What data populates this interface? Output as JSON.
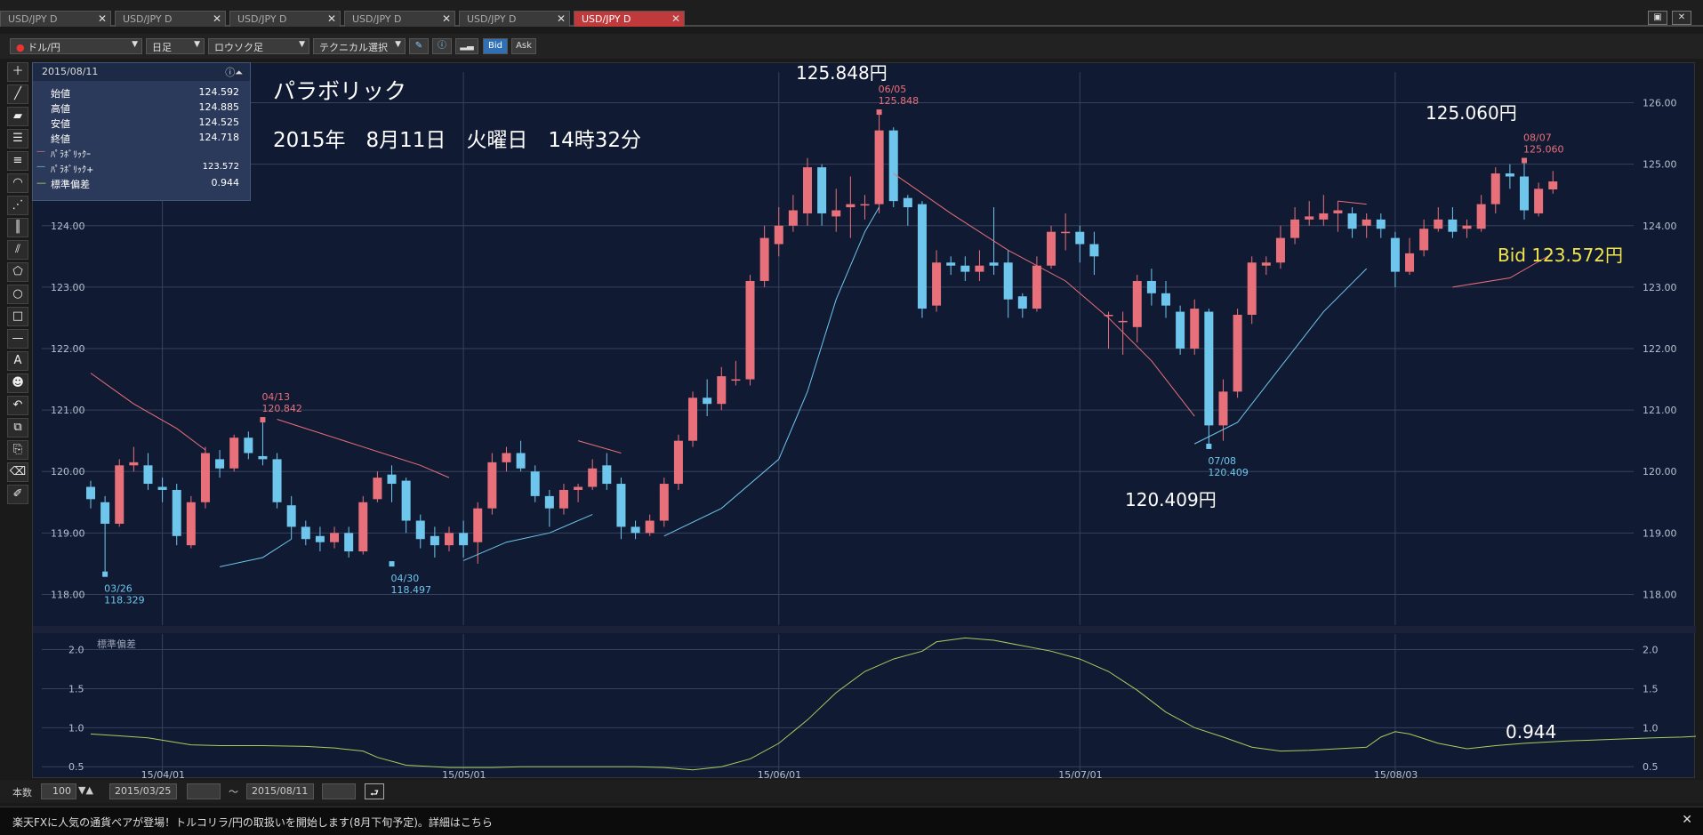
{
  "tabs": [
    {
      "label": "USD/JPY D",
      "active": false
    },
    {
      "label": "USD/JPY D",
      "active": false
    },
    {
      "label": "USD/JPY D",
      "active": false
    },
    {
      "label": "USD/JPY D",
      "active": false
    },
    {
      "label": "USD/JPY D",
      "active": false
    },
    {
      "label": "USD/JPY D",
      "active": true
    }
  ],
  "toolbar": {
    "pair": "ドル/円",
    "timeframe": "日足",
    "chart_type": "ロウソク足",
    "technical": "テクニカル選択",
    "bid": "Bid",
    "ask": "Ask"
  },
  "info": {
    "date": "2015/08/11",
    "rows": [
      {
        "label": "始値",
        "value": "124.592"
      },
      {
        "label": "高値",
        "value": "124.885"
      },
      {
        "label": "安値",
        "value": "124.525"
      },
      {
        "label": "終値",
        "value": "124.718"
      }
    ],
    "indicators": [
      {
        "label": "ﾊﾟﾗﾎﾞﾘｯｸｰ",
        "value": "",
        "color": "#e07a84"
      },
      {
        "label": "ﾊﾟﾗﾎﾞﾘｯｸ+",
        "value": "123.572",
        "color": "#6fc4e8"
      },
      {
        "label": "標準偏差",
        "value": "0.944",
        "color": "#b6e06a"
      }
    ]
  },
  "overlay": {
    "title": "パラボリック",
    "datetime": "2015年　8月11日　火曜日　14時32分",
    "high_price": "125.848円",
    "high_date": "06/05",
    "high_value": "125.848",
    "right_price": "125.060円",
    "right_date": "08/07",
    "right_value": "125.060",
    "low_price": "120.409円",
    "low_date": "07/08",
    "low_value": "120.409",
    "apr_date": "04/13",
    "apr_value": "120.842",
    "mar_date": "03/26",
    "mar_value": "118.329",
    "a30_date": "04/30",
    "a30_value": "118.497",
    "bid": "Bid 123.572円",
    "stdev_value": "0.944",
    "sub_title": "標準偏差"
  },
  "chart_data": {
    "type": "candlestick",
    "y_ticks": [
      "126.00",
      "125.00",
      "124.00",
      "123.00",
      "122.00",
      "121.00",
      "120.00",
      "119.00",
      "118.00"
    ],
    "ylim": [
      117.5,
      126.5
    ],
    "sub_y_ticks": [
      "2.0",
      "1.5",
      "1.0",
      "0.5"
    ],
    "sub_ylim": [
      0.4,
      2.2
    ],
    "x_ticks": [
      "15/04/01",
      "15/05/01",
      "15/06/01",
      "15/07/01",
      "15/08/03"
    ],
    "candles": [
      [
        119.75,
        119.55,
        119.85,
        119.4
      ],
      [
        119.5,
        119.15,
        119.6,
        118.33
      ],
      [
        119.15,
        120.1,
        120.2,
        119.1
      ],
      [
        120.1,
        120.15,
        120.4,
        120.0
      ],
      [
        120.1,
        119.8,
        120.3,
        119.7
      ],
      [
        119.75,
        119.7,
        119.9,
        119.5
      ],
      [
        119.7,
        118.95,
        119.8,
        118.8
      ],
      [
        118.8,
        119.5,
        119.6,
        118.75
      ],
      [
        119.5,
        120.3,
        120.4,
        119.4
      ],
      [
        120.2,
        120.05,
        120.35,
        119.9
      ],
      [
        120.05,
        120.55,
        120.6,
        120.0
      ],
      [
        120.55,
        120.3,
        120.65,
        120.2
      ],
      [
        120.25,
        120.2,
        120.84,
        120.1
      ],
      [
        120.2,
        119.5,
        120.3,
        119.4
      ],
      [
        119.45,
        119.1,
        119.6,
        118.9
      ],
      [
        119.1,
        118.9,
        119.2,
        118.8
      ],
      [
        118.95,
        118.85,
        119.1,
        118.7
      ],
      [
        118.85,
        119.0,
        119.1,
        118.75
      ],
      [
        119.0,
        118.7,
        119.1,
        118.6
      ],
      [
        118.7,
        119.5,
        119.6,
        118.65
      ],
      [
        119.55,
        119.9,
        120.0,
        119.5
      ],
      [
        119.95,
        119.8,
        120.1,
        119.5
      ],
      [
        119.85,
        119.2,
        119.9,
        119.0
      ],
      [
        119.2,
        118.9,
        119.3,
        118.75
      ],
      [
        118.95,
        118.8,
        119.1,
        118.6
      ],
      [
        118.8,
        119.0,
        119.1,
        118.7
      ],
      [
        119.0,
        118.8,
        119.2,
        118.6
      ],
      [
        118.85,
        119.4,
        119.5,
        118.5
      ],
      [
        119.4,
        120.15,
        120.3,
        119.3
      ],
      [
        120.15,
        120.3,
        120.4,
        120.0
      ],
      [
        120.3,
        120.05,
        120.5,
        120.0
      ],
      [
        120.0,
        119.6,
        120.1,
        119.5
      ],
      [
        119.6,
        119.4,
        119.7,
        119.1
      ],
      [
        119.4,
        119.7,
        119.8,
        119.3
      ],
      [
        119.7,
        119.75,
        119.8,
        119.5
      ],
      [
        119.75,
        120.05,
        120.2,
        119.7
      ],
      [
        120.1,
        119.8,
        120.3,
        119.7
      ],
      [
        119.8,
        119.1,
        119.9,
        118.9
      ],
      [
        119.1,
        119.0,
        119.2,
        118.9
      ],
      [
        119.0,
        119.2,
        119.3,
        118.95
      ],
      [
        119.2,
        119.8,
        119.9,
        119.1
      ],
      [
        119.8,
        120.5,
        120.6,
        119.7
      ],
      [
        120.5,
        121.2,
        121.3,
        120.4
      ],
      [
        121.2,
        121.1,
        121.5,
        120.9
      ],
      [
        121.1,
        121.55,
        121.7,
        121.0
      ],
      [
        121.5,
        121.5,
        121.8,
        121.4
      ],
      [
        121.5,
        123.1,
        123.2,
        121.4
      ],
      [
        123.1,
        123.8,
        124.0,
        123.0
      ],
      [
        123.7,
        124.0,
        124.3,
        123.5
      ],
      [
        124.0,
        124.25,
        124.5,
        123.9
      ],
      [
        124.2,
        124.95,
        125.1,
        124.0
      ],
      [
        124.95,
        124.2,
        125.0,
        124.0
      ],
      [
        124.15,
        124.25,
        124.6,
        123.9
      ],
      [
        124.3,
        124.35,
        124.8,
        123.8
      ],
      [
        124.35,
        124.35,
        124.5,
        124.1
      ],
      [
        124.35,
        125.55,
        125.85,
        124.2
      ],
      [
        125.55,
        124.4,
        125.6,
        124.3
      ],
      [
        124.45,
        124.3,
        124.5,
        124.0
      ],
      [
        124.35,
        122.65,
        124.4,
        122.5
      ],
      [
        122.7,
        123.4,
        123.6,
        122.6
      ],
      [
        123.4,
        123.35,
        123.5,
        123.2
      ],
      [
        123.35,
        123.25,
        123.5,
        123.1
      ],
      [
        123.25,
        123.35,
        123.6,
        123.1
      ],
      [
        123.4,
        123.35,
        124.3,
        123.2
      ],
      [
        123.4,
        122.8,
        123.6,
        122.5
      ],
      [
        122.85,
        122.65,
        122.9,
        122.5
      ],
      [
        122.65,
        123.35,
        123.5,
        122.6
      ],
      [
        123.35,
        123.9,
        124.0,
        123.3
      ],
      [
        123.9,
        123.9,
        124.2,
        123.6
      ],
      [
        123.9,
        123.7,
        124.0,
        123.4
      ],
      [
        123.7,
        123.5,
        123.9,
        123.2
      ],
      [
        122.55,
        122.55,
        122.6,
        122.0
      ],
      [
        122.45,
        122.45,
        122.6,
        121.9
      ],
      [
        122.35,
        123.1,
        123.2,
        122.1
      ],
      [
        123.1,
        122.9,
        123.3,
        122.7
      ],
      [
        122.9,
        122.7,
        123.1,
        122.5
      ],
      [
        122.6,
        122.0,
        122.7,
        121.9
      ],
      [
        122.0,
        122.65,
        122.8,
        121.9
      ],
      [
        122.6,
        120.75,
        122.65,
        120.41
      ],
      [
        120.75,
        121.3,
        121.5,
        120.5
      ],
      [
        121.3,
        122.55,
        122.65,
        121.2
      ],
      [
        122.55,
        123.4,
        123.5,
        122.4
      ],
      [
        123.35,
        123.4,
        123.5,
        123.2
      ],
      [
        123.4,
        123.8,
        124.0,
        123.3
      ],
      [
        123.8,
        124.1,
        124.3,
        123.7
      ],
      [
        124.1,
        124.15,
        124.4,
        124.0
      ],
      [
        124.1,
        124.2,
        124.5,
        124.0
      ],
      [
        124.2,
        124.25,
        124.4,
        123.9
      ],
      [
        124.2,
        123.95,
        124.3,
        123.8
      ],
      [
        124.0,
        124.1,
        124.2,
        123.8
      ],
      [
        124.1,
        123.95,
        124.2,
        123.8
      ],
      [
        123.8,
        123.25,
        123.9,
        123.0
      ],
      [
        123.25,
        123.55,
        123.8,
        123.2
      ],
      [
        123.6,
        123.95,
        124.1,
        123.5
      ],
      [
        123.95,
        124.1,
        124.3,
        123.9
      ],
      [
        124.1,
        123.9,
        124.3,
        123.8
      ],
      [
        123.95,
        124.0,
        124.1,
        123.8
      ],
      [
        123.95,
        124.35,
        124.5,
        123.9
      ],
      [
        124.35,
        124.85,
        124.95,
        124.2
      ],
      [
        124.85,
        124.8,
        125.0,
        124.6
      ],
      [
        124.8,
        124.25,
        125.06,
        124.1
      ],
      [
        124.2,
        124.6,
        124.7,
        124.15
      ],
      [
        124.59,
        124.72,
        124.89,
        124.52
      ]
    ],
    "sar_short": [
      [
        0,
        121.6
      ],
      [
        3,
        121.1
      ],
      [
        6,
        120.7
      ],
      [
        8,
        120.35
      ],
      [
        null,
        null
      ],
      [
        13,
        120.85
      ],
      [
        15,
        120.7
      ],
      [
        19,
        120.4
      ],
      [
        23,
        120.1
      ],
      [
        25,
        119.9
      ],
      [
        null,
        null
      ],
      [
        34,
        120.5
      ],
      [
        37,
        120.3
      ],
      [
        null,
        null
      ],
      [
        56,
        124.85
      ],
      [
        60,
        124.2
      ],
      [
        64,
        123.6
      ],
      [
        68,
        123.1
      ],
      [
        71,
        122.5
      ],
      [
        74,
        121.8
      ],
      [
        77,
        120.9
      ],
      [
        null,
        null
      ],
      [
        87,
        124.4
      ],
      [
        89,
        124.35
      ],
      [
        null,
        null
      ],
      [
        95,
        123.0
      ],
      [
        99,
        123.15
      ],
      [
        102,
        123.55
      ]
    ],
    "sar_long": [
      [
        9,
        118.45
      ],
      [
        12,
        118.6
      ],
      [
        14,
        118.9
      ],
      [
        null,
        null
      ],
      [
        26,
        118.55
      ],
      [
        29,
        118.85
      ],
      [
        32,
        119.0
      ],
      [
        35,
        119.3
      ],
      [
        null,
        null
      ],
      [
        40,
        118.95
      ],
      [
        44,
        119.4
      ],
      [
        48,
        120.2
      ],
      [
        50,
        121.3
      ],
      [
        52,
        122.8
      ],
      [
        54,
        123.9
      ],
      [
        55,
        124.3
      ],
      [
        null,
        null
      ],
      [
        77,
        120.45
      ],
      [
        80,
        120.8
      ],
      [
        83,
        121.7
      ],
      [
        86,
        122.6
      ],
      [
        89,
        123.3
      ],
      [
        null,
        null
      ]
    ],
    "stdev": [
      [
        0,
        0.92
      ],
      [
        4,
        0.87
      ],
      [
        7,
        0.78
      ],
      [
        9,
        0.77
      ],
      [
        12,
        0.77
      ],
      [
        15,
        0.76
      ],
      [
        17,
        0.74
      ],
      [
        19,
        0.7
      ],
      [
        20,
        0.62
      ],
      [
        22,
        0.52
      ],
      [
        25,
        0.49
      ],
      [
        28,
        0.49
      ],
      [
        30,
        0.5
      ],
      [
        34,
        0.5
      ],
      [
        38,
        0.5
      ],
      [
        40,
        0.49
      ],
      [
        42,
        0.46
      ],
      [
        44,
        0.5
      ],
      [
        46,
        0.6
      ],
      [
        48,
        0.8
      ],
      [
        50,
        1.1
      ],
      [
        52,
        1.45
      ],
      [
        54,
        1.72
      ],
      [
        56,
        1.88
      ],
      [
        58,
        1.98
      ],
      [
        59,
        2.1
      ],
      [
        61,
        2.15
      ],
      [
        63,
        2.12
      ],
      [
        65,
        2.05
      ],
      [
        67,
        1.98
      ],
      [
        69,
        1.88
      ],
      [
        71,
        1.72
      ],
      [
        73,
        1.48
      ],
      [
        75,
        1.2
      ],
      [
        77,
        1.0
      ],
      [
        79,
        0.88
      ],
      [
        81,
        0.75
      ],
      [
        83,
        0.7
      ],
      [
        85,
        0.71
      ],
      [
        87,
        0.73
      ],
      [
        89,
        0.75
      ],
      [
        90,
        0.88
      ],
      [
        91,
        0.95
      ],
      [
        92,
        0.92
      ],
      [
        94,
        0.8
      ],
      [
        96,
        0.73
      ],
      [
        98,
        0.77
      ],
      [
        100,
        0.8
      ],
      [
        103,
        0.83
      ],
      [
        106,
        0.85
      ],
      [
        109,
        0.87
      ],
      [
        111,
        0.88
      ],
      [
        113,
        0.9
      ],
      [
        115,
        0.92
      ],
      [
        117,
        0.94
      ],
      [
        118,
        0.944
      ]
    ]
  },
  "bottom": {
    "count_label": "本数",
    "count_value": "100",
    "from_date": "2015/03/25",
    "tilde": "～",
    "to_date": "2015/08/11"
  },
  "ticker": {
    "text": "楽天FXに人気の通貨ペアが登場！トルコリラ/円の取扱いを開始します(8月下旬予定)。詳細はこちら",
    "close": "✕"
  },
  "colors": {
    "bull": "#e8707a",
    "bear": "#6ec6ec",
    "grid": "#36415c",
    "bg": "#111a33",
    "stdev": "#a6cf5e"
  }
}
